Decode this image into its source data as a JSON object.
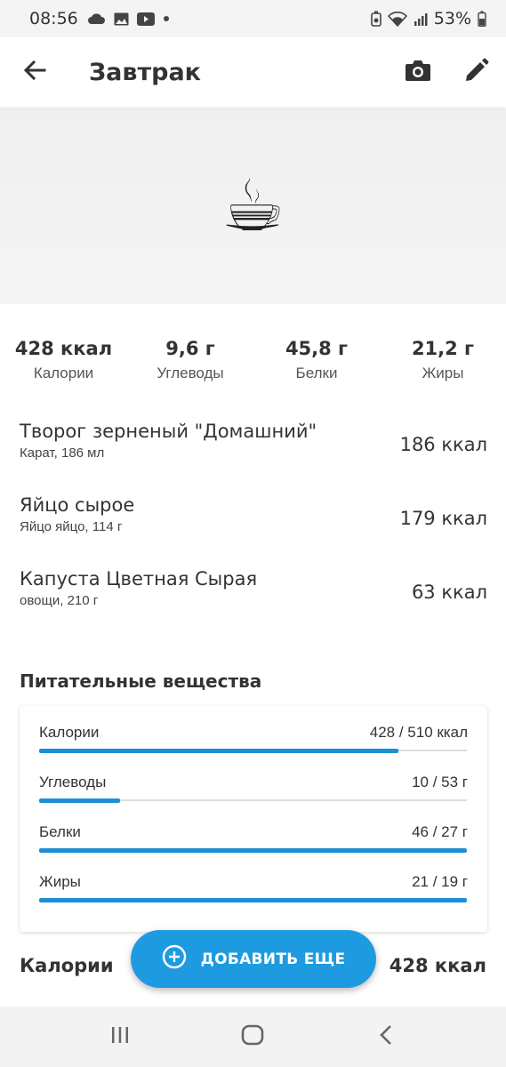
{
  "status_bar": {
    "time": "08:56",
    "battery_text": "53%",
    "left_icons": [
      "cloud-icon",
      "image-icon",
      "youtube-icon",
      "dot-icon"
    ],
    "right_icons": [
      "battery-saver-icon",
      "wifi-icon",
      "signal-icon",
      "battery-icon"
    ]
  },
  "app_bar": {
    "title": "Завтрак",
    "back_icon": "arrow-back-icon",
    "camera_icon": "camera-icon",
    "edit_icon": "pencil-icon"
  },
  "hero": {
    "emoji": "☕"
  },
  "summary": [
    {
      "value": "428 ккал",
      "label": "Калории"
    },
    {
      "value": "9,6 г",
      "label": "Углеводы"
    },
    {
      "value": "45,8 г",
      "label": "Белки"
    },
    {
      "value": "21,2 г",
      "label": "Жиры"
    }
  ],
  "foods": [
    {
      "name": "Творог зерненый \"Домашний\"",
      "sub": "Карат, 186 мл",
      "kcal": "186 ккал"
    },
    {
      "name": "Яйцо сырое",
      "sub": "Яйцо яйцо, 114 г",
      "kcal": "179 ккал"
    },
    {
      "name": "Капуста Цветная Сырая",
      "sub": "овощи, 210 г",
      "kcal": "63 ккал"
    }
  ],
  "nutrients": {
    "title": "Питательные вещества",
    "bar_color": "#1e8fd6",
    "rows": [
      {
        "label": "Калории",
        "value": "428 / 510 ккал",
        "progress": 0.84
      },
      {
        "label": "Углеводы",
        "value": "10 / 53 г",
        "progress": 0.19
      },
      {
        "label": "Белки",
        "value": "46 / 27 г",
        "progress": 1.0
      },
      {
        "label": "Жиры",
        "value": "21 / 19 г",
        "progress": 1.0
      }
    ]
  },
  "footer": {
    "label": "Калории",
    "value": "428 ккал"
  },
  "fab": {
    "label": "ДОБАВИТЬ ЕЩЕ",
    "icon": "plus-circle-icon",
    "color": "#1e9be0"
  },
  "nav_bar": {
    "icons": [
      "recents-icon",
      "home-icon",
      "back-icon"
    ]
  }
}
